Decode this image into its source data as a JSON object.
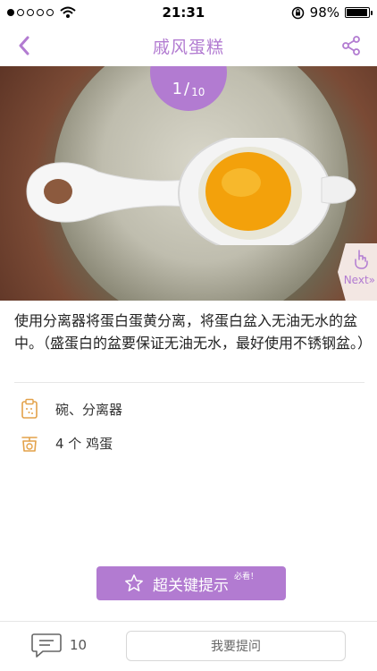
{
  "status_bar": {
    "time": "21:31",
    "battery": "98%",
    "battery_level": 0.98
  },
  "nav": {
    "title": "戚风蛋糕"
  },
  "step": {
    "current": "1",
    "total": "10",
    "next_label": "Next»"
  },
  "instruction": {
    "text": "使用分离器将蛋白蛋黄分离，将蛋白盆入无油无水的盆中。（盛蛋白的盆要保证无油无水，最好使用不锈钢盆。）"
  },
  "details": {
    "tools": "碗、分离器",
    "ingredients": "4 个 鸡蛋"
  },
  "tips_button": {
    "label": "超关键提示",
    "badge": "必看！"
  },
  "bottom_bar": {
    "comment_count": "10",
    "ask_label": "我要提问"
  },
  "colors": {
    "accent": "#b27bd1",
    "icon_orange": "#e3a24a"
  }
}
